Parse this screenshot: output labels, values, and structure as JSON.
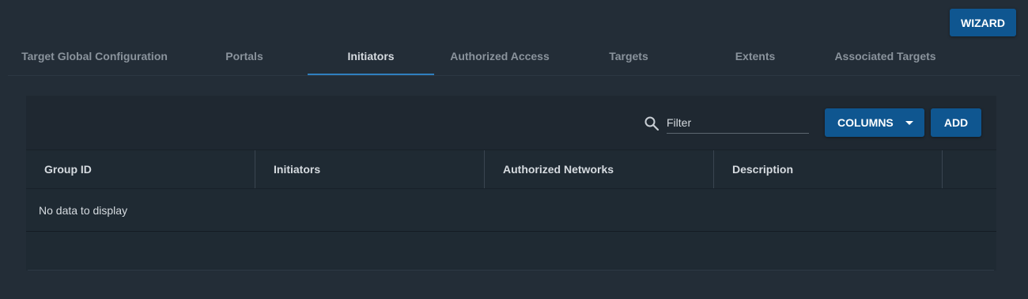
{
  "header": {
    "wizard_label": "WIZARD"
  },
  "tabs": [
    {
      "label": "Target Global Configuration"
    },
    {
      "label": "Portals"
    },
    {
      "label": "Initiators"
    },
    {
      "label": "Authorized Access"
    },
    {
      "label": "Targets"
    },
    {
      "label": "Extents"
    },
    {
      "label": "Associated Targets"
    }
  ],
  "active_tab": "Initiators",
  "toolbar": {
    "search_icon": "search-icon",
    "filter_placeholder": "Filter",
    "filter_value": "",
    "columns_label": "COLUMNS",
    "add_label": "ADD"
  },
  "table": {
    "columns": [
      "Group ID",
      "Initiators",
      "Authorized Networks",
      "Description"
    ],
    "empty_message": "No data to display"
  },
  "colors": {
    "background": "#232d37",
    "card": "#1f2a33",
    "accent": "#0f5690",
    "tab_indicator": "#2f7fbf"
  }
}
